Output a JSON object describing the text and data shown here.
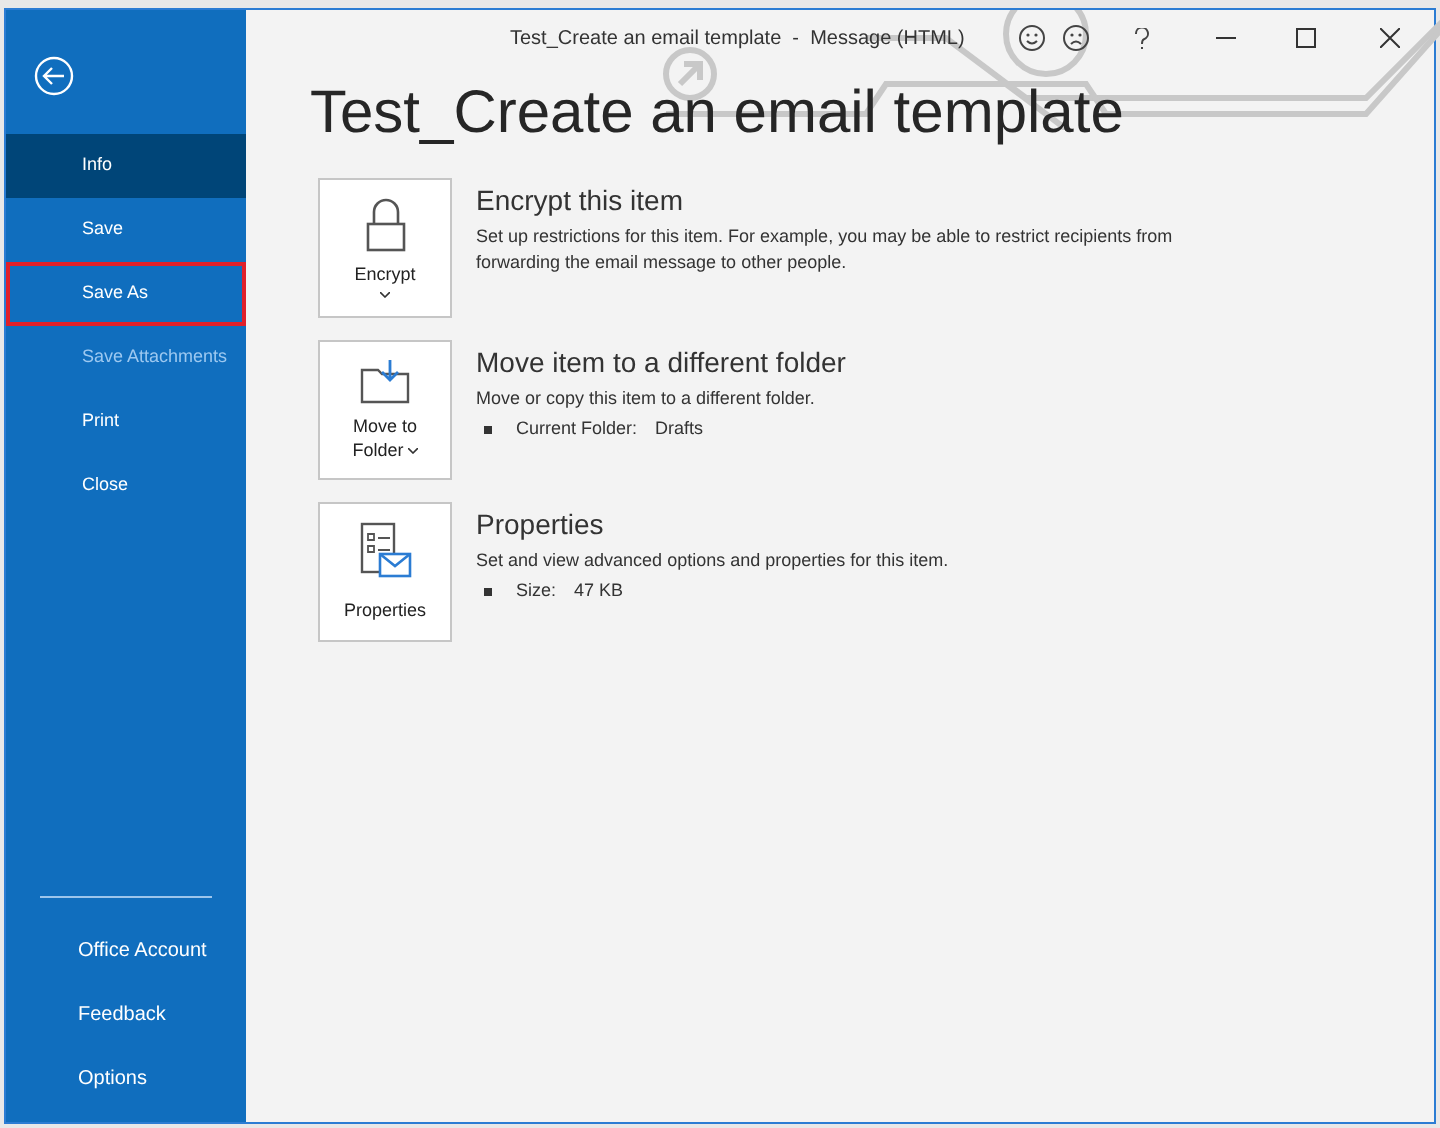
{
  "window": {
    "title": "Test_Create an email template  -  Message (HTML)"
  },
  "sidebar": {
    "items": [
      {
        "label": "Info",
        "selected": true,
        "disabled": false,
        "highlighted": false
      },
      {
        "label": "Save",
        "selected": false,
        "disabled": false,
        "highlighted": false
      },
      {
        "label": "Save As",
        "selected": false,
        "disabled": false,
        "highlighted": true
      },
      {
        "label": "Save Attachments",
        "selected": false,
        "disabled": true,
        "highlighted": false
      },
      {
        "label": "Print",
        "selected": false,
        "disabled": false,
        "highlighted": false
      },
      {
        "label": "Close",
        "selected": false,
        "disabled": false,
        "highlighted": false
      }
    ],
    "bottom_items": [
      {
        "label": "Office Account"
      },
      {
        "label": "Feedback"
      },
      {
        "label": "Options"
      }
    ]
  },
  "page_title": "Test_Create an email template",
  "sections": [
    {
      "kind": "encrypt",
      "button_lines": [
        "Encrypt"
      ],
      "title": "Encrypt this item",
      "description": "Set up restrictions for this item. For example, you may be able to restrict recipients from forwarding the email message to other people."
    },
    {
      "kind": "move",
      "button_lines": [
        "Move to",
        "Folder"
      ],
      "title": "Move item to a different folder",
      "description": "Move or copy this item to a different folder.",
      "details": [
        {
          "label": "Current Folder:",
          "value": "Drafts"
        }
      ]
    },
    {
      "kind": "properties",
      "button_lines": [
        "Properties"
      ],
      "title": "Properties",
      "description": "Set and view advanced options and properties for this item.",
      "details": [
        {
          "label": "Size:",
          "value": "47 KB"
        }
      ]
    }
  ]
}
